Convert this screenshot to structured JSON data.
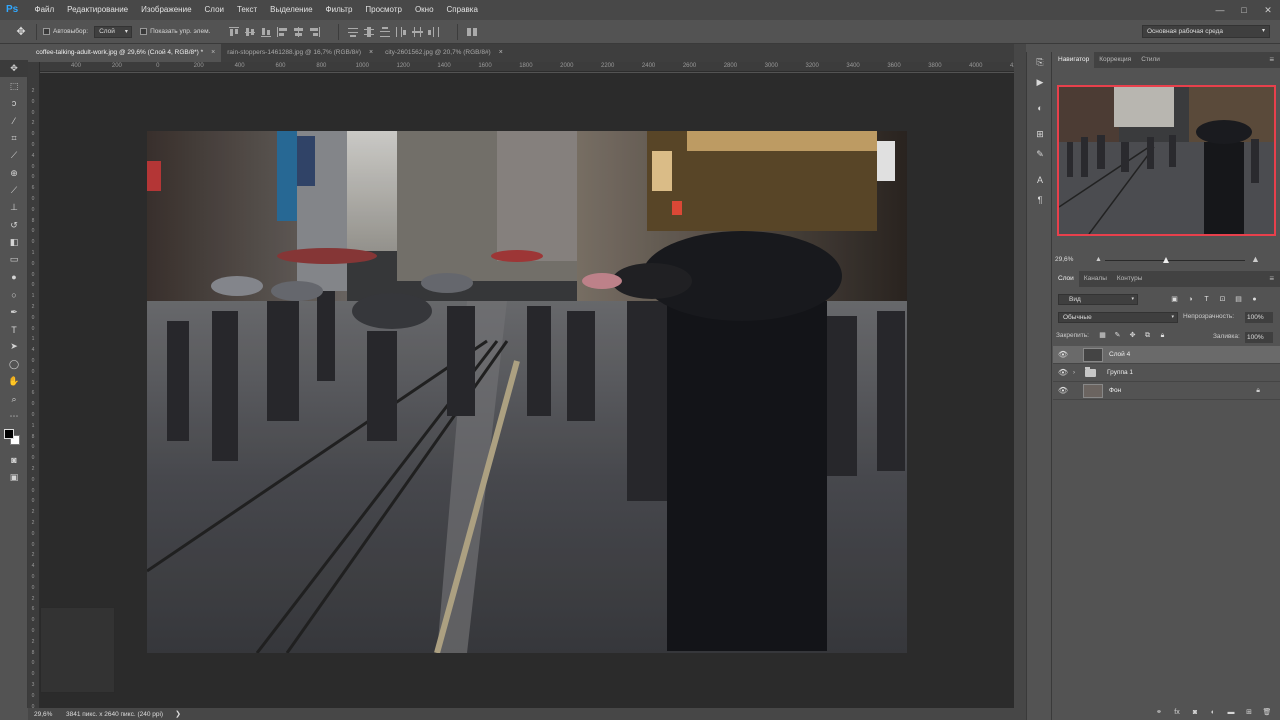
{
  "app": {
    "logo": "Ps"
  },
  "menubar": {
    "items": [
      "Файл",
      "Редактирование",
      "Изображение",
      "Слои",
      "Текст",
      "Выделение",
      "Фильтр",
      "Просмотр",
      "Окно",
      "Справка"
    ],
    "window_buttons": [
      "—",
      "□",
      "✕"
    ]
  },
  "options": {
    "autoselect_label": "Автовыбор:",
    "autoselect_target": "Слой",
    "show_transform_label": "Показать упр. элем.",
    "workspace": "Основная рабочая среда"
  },
  "tabs": [
    {
      "label": "coffee-talking-adult-work.jpg @ 29,6% (Слой 4, RGB/8*) *",
      "active": true
    },
    {
      "label": "rain-stoppers-1461288.jpg @ 16,7% (RGB/8#)",
      "active": false
    },
    {
      "label": "city-2601562.jpg @ 20,7% (RGB/8#)",
      "active": false
    }
  ],
  "ruler": {
    "top": [
      "400",
      "200",
      "0",
      "200",
      "400",
      "600",
      "800",
      "1000",
      "1200",
      "1400",
      "1600",
      "1800",
      "2000",
      "2200",
      "2400",
      "2600",
      "2800",
      "3000",
      "3200",
      "3400",
      "3600",
      "3800",
      "4000",
      "4200"
    ],
    "left": [
      "2",
      "0",
      "0",
      "2",
      "0",
      "0",
      "4",
      "0",
      "0",
      "6",
      "0",
      "0",
      "8",
      "0",
      "0",
      "1",
      "0",
      "0",
      "0",
      "1",
      "2",
      "0",
      "0",
      "1",
      "4",
      "0",
      "0",
      "1",
      "6",
      "0",
      "0",
      "1",
      "8",
      "0",
      "0",
      "2",
      "0",
      "0",
      "0",
      "2",
      "2",
      "0",
      "0",
      "2",
      "4",
      "0",
      "0",
      "2",
      "6",
      "0",
      "0",
      "2",
      "8",
      "0",
      "0",
      "3",
      "0",
      "0",
      "0"
    ]
  },
  "status": {
    "zoom": "29,6%",
    "info": "3841 пикс. x 2640 пикс. (240 ppi)",
    "arrow": "❯"
  },
  "right_strip": {
    "icons": [
      "history-icon",
      "play-icon",
      "adjust-icon",
      "brush-settings-icon",
      "brush-icon",
      "character-icon",
      "paragraph-icon"
    ]
  },
  "navigator": {
    "tabs": [
      "Навигатор",
      "Коррекция",
      "Стили"
    ],
    "zoom": "29,6%"
  },
  "layers": {
    "tabs": [
      "Слои",
      "Каналы",
      "Контуры"
    ],
    "kind": "Вид",
    "blend_mode": "Обычные",
    "opacity_label": "Непрозрачность:",
    "opacity": "100%",
    "lock_label": "Закрепить:",
    "fill_label": "Заливка:",
    "fill": "100%",
    "items": [
      {
        "name": "Слой 4",
        "type": "layer",
        "selected": true,
        "visible": true
      },
      {
        "name": "Группа 1",
        "type": "group",
        "selected": false,
        "visible": true
      },
      {
        "name": "Фон",
        "type": "background",
        "selected": false,
        "visible": true,
        "locked": true
      }
    ]
  },
  "colors": {
    "accent_nav_frame": "#e8404c",
    "ps_blue": "#31a8ff"
  }
}
